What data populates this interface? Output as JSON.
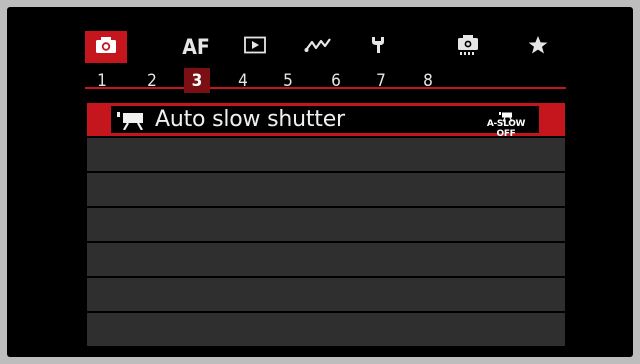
{
  "tabs": [
    {
      "name": "shooting",
      "icon": "camera-icon",
      "label": ""
    },
    {
      "name": "autofocus",
      "icon": "",
      "label": "AF"
    },
    {
      "name": "playback",
      "icon": "play-icon",
      "label": ""
    },
    {
      "name": "wireless",
      "icon": "wireless-icon",
      "label": ""
    },
    {
      "name": "setup",
      "icon": "wrench-icon",
      "label": ""
    },
    {
      "name": "custom",
      "icon": "custom-functions-camera-icon",
      "label": ""
    },
    {
      "name": "my-menu",
      "icon": "star-icon",
      "label": ""
    }
  ],
  "active_tab": "shooting",
  "pages": [
    "1",
    "2",
    "3",
    "4",
    "5",
    "6",
    "7",
    "8"
  ],
  "active_page": "3",
  "menu": {
    "items": [
      {
        "label": "Auto slow shutter",
        "icon": "movie-camera-icon",
        "value": "A-SLOW OFF",
        "value_icon": "movie-camera-icon"
      },
      {
        "label": ""
      },
      {
        "label": ""
      },
      {
        "label": ""
      },
      {
        "label": ""
      },
      {
        "label": ""
      },
      {
        "label": ""
      }
    ],
    "selected_index": 0
  },
  "colors": {
    "accent": "#c4161c",
    "active_page": "#7a1013",
    "row_bg": "#2f2f2f",
    "screen_bg": "#000000",
    "frame_bg": "#bdbdbd"
  }
}
